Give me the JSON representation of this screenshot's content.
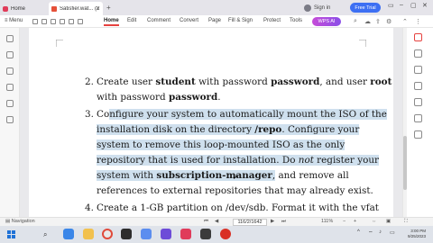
{
  "tabs": [
    {
      "label": "Home"
    },
    {
      "label": "Satisfier.wat... (2023)(3)"
    }
  ],
  "header": {
    "sign_in": "Sign in",
    "free_trial": "Free Trial"
  },
  "menu": {
    "menu_label": "Menu",
    "items": [
      "Home",
      "Edit",
      "Comment",
      "Convert",
      "Page",
      "Fill & Sign",
      "Protect",
      "Tools"
    ],
    "active": "Home",
    "ai_label": "WPS AI"
  },
  "document": {
    "item2": {
      "num": "2.",
      "line1": [
        "Create user ",
        "student",
        " with password ",
        "password",
        ", and user ",
        "root"
      ],
      "line2": [
        "with password ",
        "password",
        "."
      ]
    },
    "item3": {
      "num": "3.",
      "line1_pre": "Co",
      "line1_hl": "nfigure your system to automatically mount the ISO of the",
      "line2_hl_a": "installation disk on the directory ",
      "line2_hl_b": "/repo",
      "line2_hl_c": ". Configure your",
      "line3_hl": "system to remove this loop-mounted ISO as the only",
      "line4_hl_a": "repository that is used for installation. Do ",
      "line4_hl_b": "not",
      "line4_hl_c": " register your",
      "line5_hl_a": "system with ",
      "line5_hl_b": "subscription-manager",
      "line5_hl_c": ",",
      "line5_post": " and remove all",
      "line6": "references to external repositories that may already exist."
    },
    "item4": {
      "num": "4.",
      "line1": "Create a 1-GB partition on /dev/sdb. Format it with the vfat"
    }
  },
  "statusbar": {
    "navigation": "Navigation",
    "page_box": "116/2/1642",
    "zoom": "111%"
  },
  "taskbar": {
    "time": "3:00 PM",
    "date": "9/25/2023"
  },
  "colors": {
    "highlight": "#cfe0ee",
    "accent_red": "#e6423f",
    "free_trial_blue": "#3d6ff3"
  }
}
